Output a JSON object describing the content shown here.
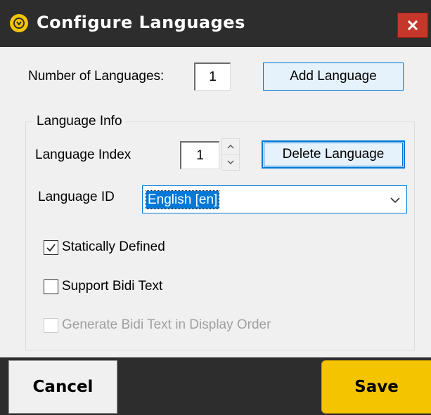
{
  "window": {
    "title": "Configure Languages",
    "icon": "app-logo-icon",
    "close_icon": "close-icon"
  },
  "fields": {
    "number_of_languages_label": "Number of Languages:",
    "number_of_languages_value": "1",
    "add_language_label": "Add Language"
  },
  "group": {
    "title": "Language Info",
    "language_index_label": "Language Index",
    "language_index_value": "1",
    "delete_language_label": "Delete Language",
    "language_id_label": "Language ID",
    "language_id_value": "English [en]"
  },
  "checkboxes": [
    {
      "label": "Statically Defined",
      "checked": true,
      "enabled": true
    },
    {
      "label": "Support Bidi Text",
      "checked": false,
      "enabled": true
    },
    {
      "label": "Generate Bidi Text in Display Order",
      "checked": false,
      "enabled": false
    }
  ],
  "footer": {
    "cancel_label": "Cancel",
    "save_label": "Save"
  },
  "colors": {
    "titlebar": "#2d2d2d",
    "accent_yellow": "#f5c400",
    "close_red": "#c6372b",
    "focus_blue": "#0078d7"
  }
}
